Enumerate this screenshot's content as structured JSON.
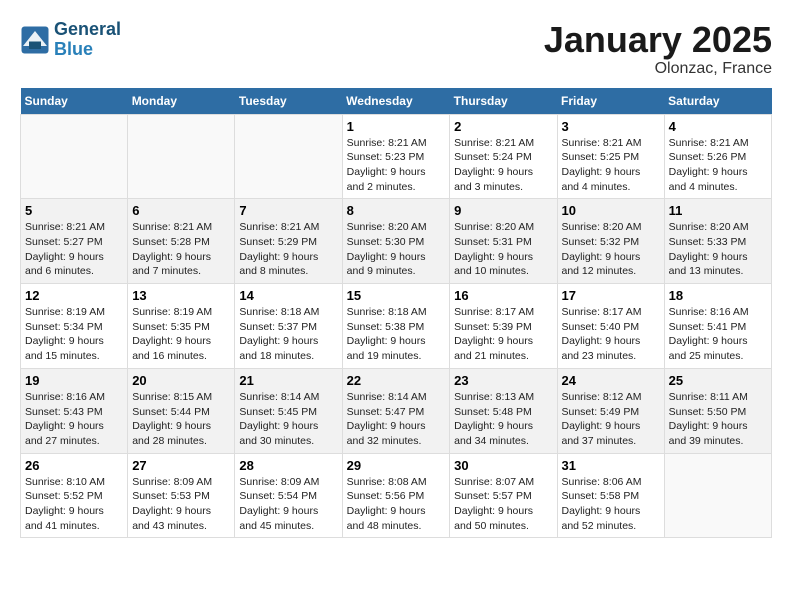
{
  "header": {
    "logo_line1": "General",
    "logo_line2": "Blue",
    "month": "January 2025",
    "location": "Olonzac, France"
  },
  "weekdays": [
    "Sunday",
    "Monday",
    "Tuesday",
    "Wednesday",
    "Thursday",
    "Friday",
    "Saturday"
  ],
  "weeks": [
    [
      {
        "day": "",
        "detail": ""
      },
      {
        "day": "",
        "detail": ""
      },
      {
        "day": "",
        "detail": ""
      },
      {
        "day": "1",
        "detail": "Sunrise: 8:21 AM\nSunset: 5:23 PM\nDaylight: 9 hours and 2 minutes."
      },
      {
        "day": "2",
        "detail": "Sunrise: 8:21 AM\nSunset: 5:24 PM\nDaylight: 9 hours and 3 minutes."
      },
      {
        "day": "3",
        "detail": "Sunrise: 8:21 AM\nSunset: 5:25 PM\nDaylight: 9 hours and 4 minutes."
      },
      {
        "day": "4",
        "detail": "Sunrise: 8:21 AM\nSunset: 5:26 PM\nDaylight: 9 hours and 4 minutes."
      }
    ],
    [
      {
        "day": "5",
        "detail": "Sunrise: 8:21 AM\nSunset: 5:27 PM\nDaylight: 9 hours and 6 minutes."
      },
      {
        "day": "6",
        "detail": "Sunrise: 8:21 AM\nSunset: 5:28 PM\nDaylight: 9 hours and 7 minutes."
      },
      {
        "day": "7",
        "detail": "Sunrise: 8:21 AM\nSunset: 5:29 PM\nDaylight: 9 hours and 8 minutes."
      },
      {
        "day": "8",
        "detail": "Sunrise: 8:20 AM\nSunset: 5:30 PM\nDaylight: 9 hours and 9 minutes."
      },
      {
        "day": "9",
        "detail": "Sunrise: 8:20 AM\nSunset: 5:31 PM\nDaylight: 9 hours and 10 minutes."
      },
      {
        "day": "10",
        "detail": "Sunrise: 8:20 AM\nSunset: 5:32 PM\nDaylight: 9 hours and 12 minutes."
      },
      {
        "day": "11",
        "detail": "Sunrise: 8:20 AM\nSunset: 5:33 PM\nDaylight: 9 hours and 13 minutes."
      }
    ],
    [
      {
        "day": "12",
        "detail": "Sunrise: 8:19 AM\nSunset: 5:34 PM\nDaylight: 9 hours and 15 minutes."
      },
      {
        "day": "13",
        "detail": "Sunrise: 8:19 AM\nSunset: 5:35 PM\nDaylight: 9 hours and 16 minutes."
      },
      {
        "day": "14",
        "detail": "Sunrise: 8:18 AM\nSunset: 5:37 PM\nDaylight: 9 hours and 18 minutes."
      },
      {
        "day": "15",
        "detail": "Sunrise: 8:18 AM\nSunset: 5:38 PM\nDaylight: 9 hours and 19 minutes."
      },
      {
        "day": "16",
        "detail": "Sunrise: 8:17 AM\nSunset: 5:39 PM\nDaylight: 9 hours and 21 minutes."
      },
      {
        "day": "17",
        "detail": "Sunrise: 8:17 AM\nSunset: 5:40 PM\nDaylight: 9 hours and 23 minutes."
      },
      {
        "day": "18",
        "detail": "Sunrise: 8:16 AM\nSunset: 5:41 PM\nDaylight: 9 hours and 25 minutes."
      }
    ],
    [
      {
        "day": "19",
        "detail": "Sunrise: 8:16 AM\nSunset: 5:43 PM\nDaylight: 9 hours and 27 minutes."
      },
      {
        "day": "20",
        "detail": "Sunrise: 8:15 AM\nSunset: 5:44 PM\nDaylight: 9 hours and 28 minutes."
      },
      {
        "day": "21",
        "detail": "Sunrise: 8:14 AM\nSunset: 5:45 PM\nDaylight: 9 hours and 30 minutes."
      },
      {
        "day": "22",
        "detail": "Sunrise: 8:14 AM\nSunset: 5:47 PM\nDaylight: 9 hours and 32 minutes."
      },
      {
        "day": "23",
        "detail": "Sunrise: 8:13 AM\nSunset: 5:48 PM\nDaylight: 9 hours and 34 minutes."
      },
      {
        "day": "24",
        "detail": "Sunrise: 8:12 AM\nSunset: 5:49 PM\nDaylight: 9 hours and 37 minutes."
      },
      {
        "day": "25",
        "detail": "Sunrise: 8:11 AM\nSunset: 5:50 PM\nDaylight: 9 hours and 39 minutes."
      }
    ],
    [
      {
        "day": "26",
        "detail": "Sunrise: 8:10 AM\nSunset: 5:52 PM\nDaylight: 9 hours and 41 minutes."
      },
      {
        "day": "27",
        "detail": "Sunrise: 8:09 AM\nSunset: 5:53 PM\nDaylight: 9 hours and 43 minutes."
      },
      {
        "day": "28",
        "detail": "Sunrise: 8:09 AM\nSunset: 5:54 PM\nDaylight: 9 hours and 45 minutes."
      },
      {
        "day": "29",
        "detail": "Sunrise: 8:08 AM\nSunset: 5:56 PM\nDaylight: 9 hours and 48 minutes."
      },
      {
        "day": "30",
        "detail": "Sunrise: 8:07 AM\nSunset: 5:57 PM\nDaylight: 9 hours and 50 minutes."
      },
      {
        "day": "31",
        "detail": "Sunrise: 8:06 AM\nSunset: 5:58 PM\nDaylight: 9 hours and 52 minutes."
      },
      {
        "day": "",
        "detail": ""
      }
    ]
  ]
}
